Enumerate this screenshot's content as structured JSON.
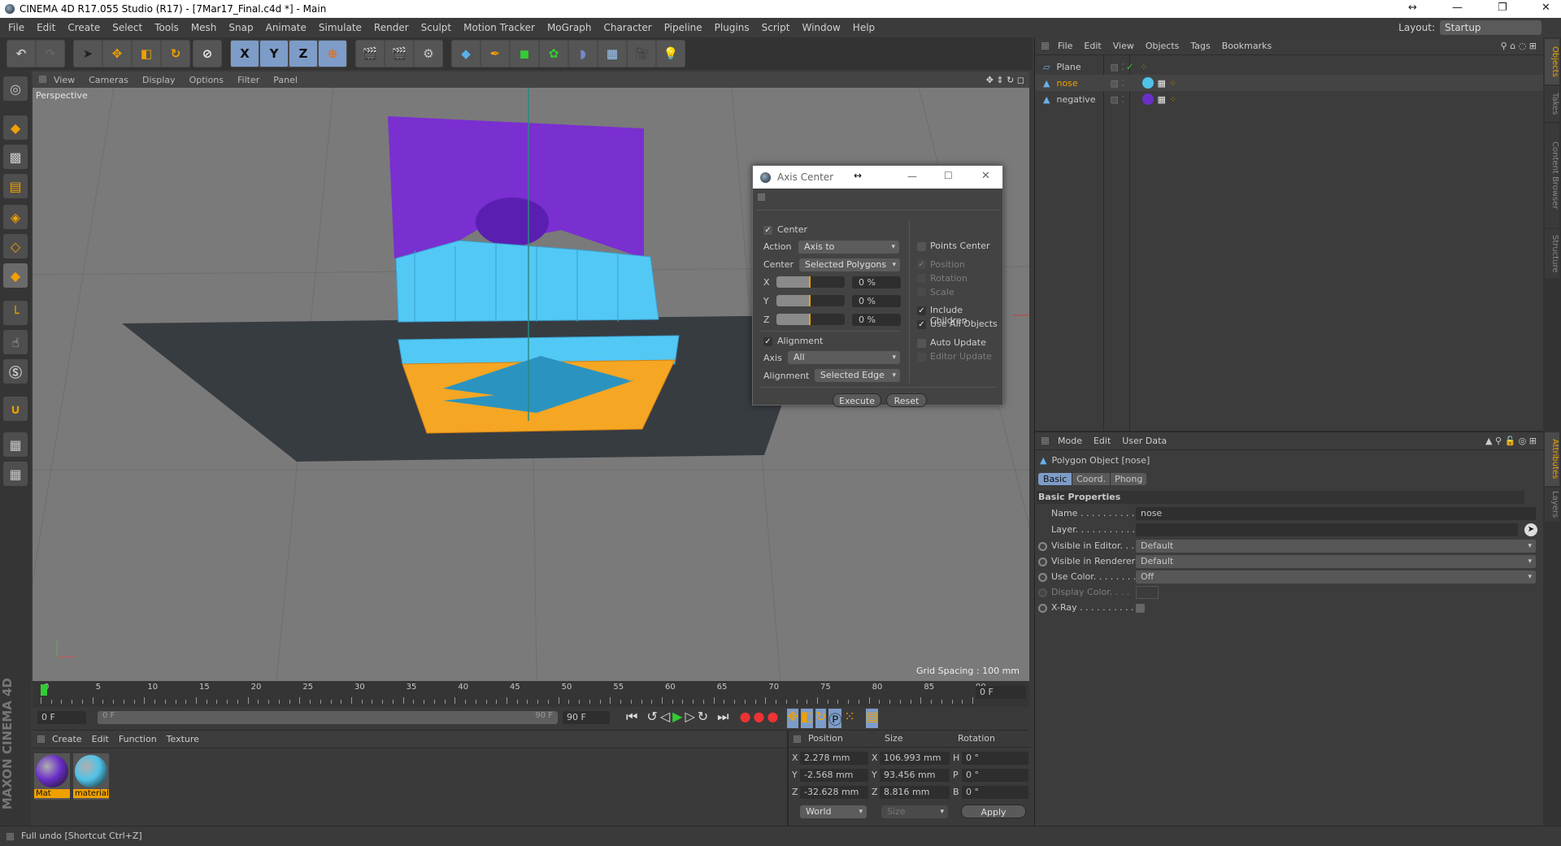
{
  "window": {
    "title": "CINEMA 4D R17.055 Studio (R17) - [7Mar17_Final.c4d *] - Main",
    "layout_label": "Layout:",
    "layout_value": "Startup"
  },
  "menu": [
    "File",
    "Edit",
    "Create",
    "Select",
    "Tools",
    "Mesh",
    "Snap",
    "Animate",
    "Simulate",
    "Render",
    "Sculpt",
    "Motion Tracker",
    "MoGraph",
    "Character",
    "Pipeline",
    "Plugins",
    "Script",
    "Window",
    "Help"
  ],
  "toolbar": {
    "axis_x": "X",
    "axis_y": "Y",
    "axis_z": "Z"
  },
  "viewport": {
    "menu": [
      "View",
      "Cameras",
      "Display",
      "Options",
      "Filter",
      "Panel"
    ],
    "label": "Perspective",
    "grid_spacing": "Grid Spacing : 100 mm"
  },
  "colors": {
    "accent": "#f0a000",
    "selected_blue": "#7d9cc8",
    "purple": "#7a2fd0",
    "cyan": "#4fc3f7",
    "orange": "#f5a623"
  },
  "dialog": {
    "title": "Axis Center",
    "center_label": "Center",
    "center_checked": true,
    "action_label": "Action",
    "action_value": "Axis to",
    "center_sel_label": "Center",
    "center_value": "Selected Polygons",
    "x_label": "X",
    "x_value": "0 %",
    "y_label": "Y",
    "y_value": "0 %",
    "z_label": "Z",
    "z_value": "0 %",
    "slider_fraction": 0.5,
    "alignment_label": "Alignment",
    "alignment_checked": true,
    "axis_label": "Axis",
    "axis_value": "All",
    "alignment_sel_label": "Alignment",
    "alignment_value": "Selected Edge",
    "points_center": "Points Center",
    "position": "Position",
    "rotation": "Rotation",
    "scale": "Scale",
    "include_children": "Include Children",
    "use_all_objects": "Use All Objects",
    "auto_update": "Auto Update",
    "editor_update": "Editor Update",
    "execute": "Execute",
    "reset": "Reset"
  },
  "objects": {
    "menu": [
      "File",
      "Edit",
      "View",
      "Objects",
      "Tags",
      "Bookmarks"
    ],
    "items": [
      {
        "name": "Plane"
      },
      {
        "name": "nose",
        "selected": true
      },
      {
        "name": "negative"
      }
    ]
  },
  "side_tabs": [
    "Objects",
    "Takes",
    "Content Browser",
    "Structure"
  ],
  "attr_tabs": [
    "Attributes",
    "Layers"
  ],
  "attributes": {
    "menu": [
      "Mode",
      "Edit",
      "User Data"
    ],
    "object_title": "Polygon Object [nose]",
    "tabs": [
      "Basic",
      "Coord.",
      "Phong"
    ],
    "section": "Basic Properties",
    "name_label": "Name . . . . . . . . . . . .",
    "name_value": "nose",
    "layer_label": "Layer. . . . . . . . . . . . .",
    "vis_editor_label": "Visible in Editor. . .",
    "vis_editor_value": "Default",
    "vis_render_label": "Visible in Renderer",
    "vis_render_value": "Default",
    "use_color_label": "Use Color. . . . . . . .",
    "use_color_value": "Off",
    "display_color_label": "Display Color. . . .",
    "xray_label": "X-Ray . . . . . . . . . . ."
  },
  "timeline": {
    "ticks": [
      "0",
      "5",
      "10",
      "15",
      "20",
      "25",
      "30",
      "35",
      "40",
      "45",
      "50",
      "55",
      "60",
      "65",
      "70",
      "75",
      "80",
      "85",
      "90"
    ],
    "current": "0 F",
    "start": "0 F",
    "range_start": "0 F",
    "range_end": "90 F",
    "end": "90 F"
  },
  "materials": {
    "menu": [
      "Create",
      "Edit",
      "Function",
      "Texture"
    ],
    "items": [
      {
        "name": "Mat",
        "color": "#6a2fc8"
      },
      {
        "name": "material",
        "color": "#4fc3e8"
      }
    ]
  },
  "coords": {
    "headers": [
      "Position",
      "Size",
      "Rotation"
    ],
    "rows": [
      {
        "axis": "X",
        "pos": "2.278 mm",
        "size_axis": "X",
        "size": "106.993 mm",
        "rot_axis": "H",
        "rot": "0 °"
      },
      {
        "axis": "Y",
        "pos": "-2.568 mm",
        "size_axis": "Y",
        "size": "93.456 mm",
        "rot_axis": "P",
        "rot": "0 °"
      },
      {
        "axis": "Z",
        "pos": "-32.628 mm",
        "size_axis": "Z",
        "size": "8.816 mm",
        "rot_axis": "B",
        "rot": "0 °"
      }
    ],
    "mode": "World",
    "size_mode": "Size",
    "apply": "Apply"
  },
  "branding": "MAXON CINEMA 4D",
  "status": "Full undo [Shortcut Ctrl+Z]"
}
